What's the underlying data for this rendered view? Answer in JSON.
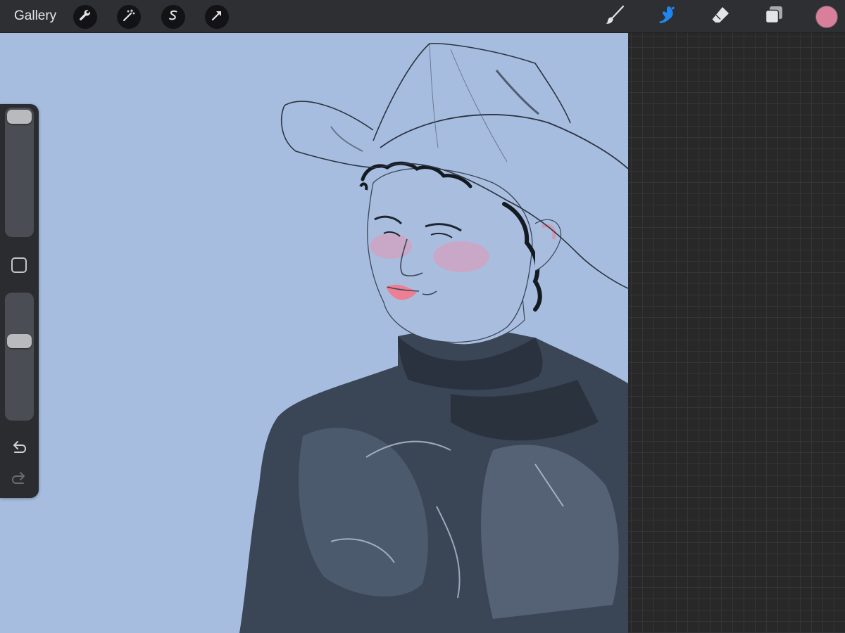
{
  "toolbar": {
    "gallery_label": "Gallery",
    "left_tools": [
      "wrench-icon",
      "magic-wand-icon",
      "selection-icon",
      "transform-arrow-icon"
    ],
    "right_tools": [
      "brush-icon",
      "smudge-icon",
      "eraser-icon",
      "layers-icon"
    ],
    "active_tool": "smudge-icon",
    "current_color": "#d97f9b"
  },
  "sidebar": {
    "brush_size_level": 0.0,
    "opacity_level": 0.36,
    "undo_enabled": true,
    "redo_enabled": false
  },
  "canvas": {
    "background_color": "#a6bde0",
    "accent_color": "#2a86f0"
  }
}
